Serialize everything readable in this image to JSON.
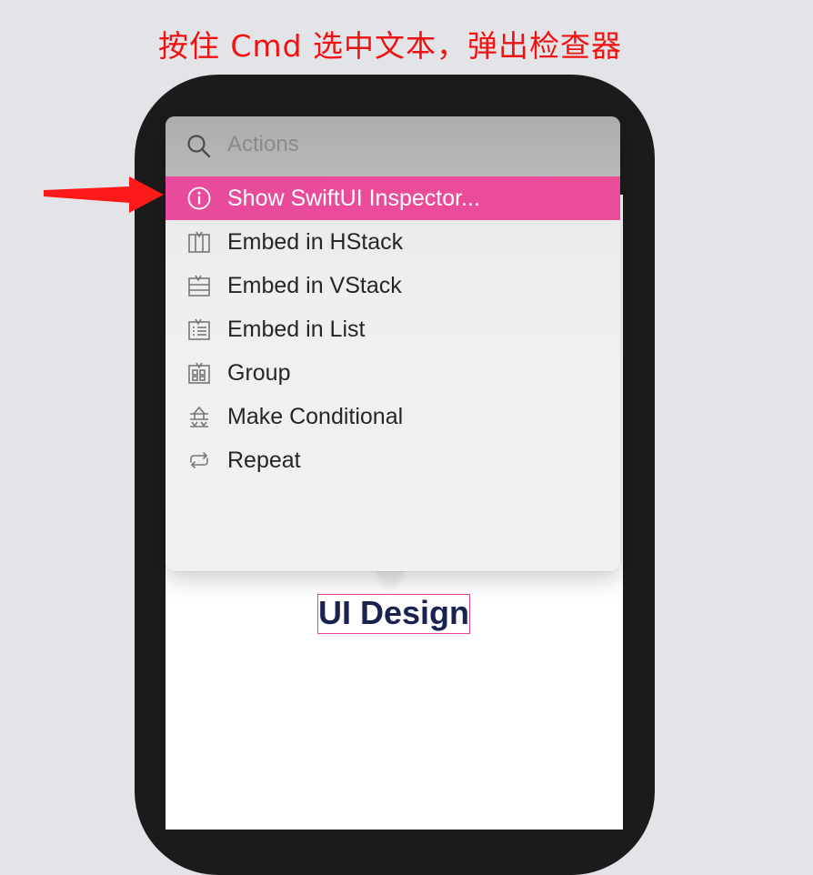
{
  "annotation": {
    "caption": "按住 Cmd 选中文本，弹出检查器",
    "arrow_color": "#ff1a1a"
  },
  "canvas": {
    "selected_text": "UI Design",
    "selection_color": "#e0469a"
  },
  "popover": {
    "search": {
      "icon": "search-icon",
      "placeholder": "Actions"
    },
    "items": [
      {
        "label": "Show SwiftUI Inspector...",
        "icon": "info-icon",
        "selected": true
      },
      {
        "label": "Embed in HStack",
        "icon": "hstack-icon",
        "selected": false
      },
      {
        "label": "Embed in VStack",
        "icon": "vstack-icon",
        "selected": false
      },
      {
        "label": "Embed in List",
        "icon": "list-icon",
        "selected": false
      },
      {
        "label": "Group",
        "icon": "group-icon",
        "selected": false
      },
      {
        "label": "Make Conditional",
        "icon": "conditional-icon",
        "selected": false
      },
      {
        "label": "Repeat",
        "icon": "repeat-icon",
        "selected": false
      }
    ],
    "highlight_color": "#e94b9c"
  }
}
